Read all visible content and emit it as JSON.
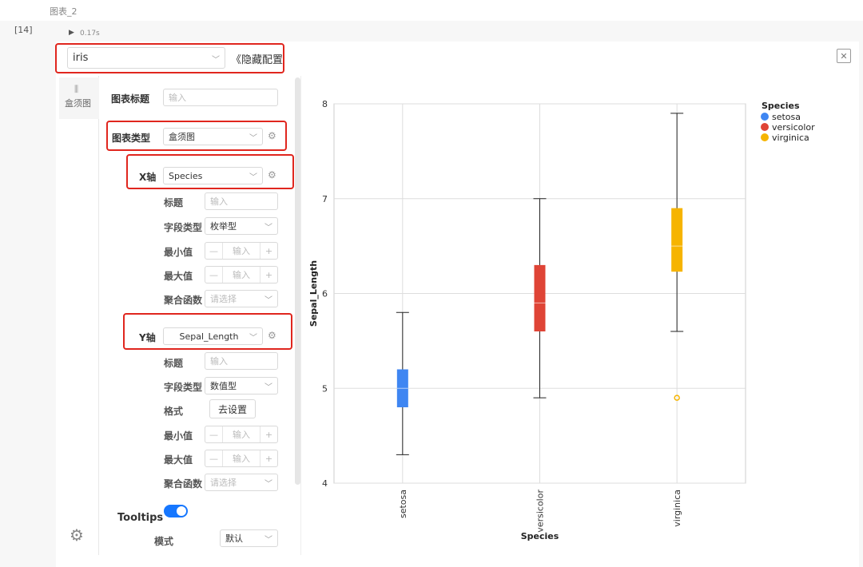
{
  "notebook": {
    "cell_title": "图表_2",
    "exec_count": "[14]",
    "run_time": "0.17s"
  },
  "dataset": {
    "selected": "iris",
    "hide_config_label": "《隐藏配置"
  },
  "sidebar": {
    "tab_label": "盒须图"
  },
  "config": {
    "chart_title_label": "图表标题",
    "chart_title_placeholder": "输入",
    "chart_type_label": "图表类型",
    "chart_type_value": "盒须图",
    "x_axis": {
      "label": "X轴",
      "field": "Species",
      "title_label": "标题",
      "title_placeholder": "输入",
      "field_type_label": "字段类型",
      "field_type_value": "枚举型",
      "min_label": "最小值",
      "min_placeholder": "输入",
      "max_label": "最大值",
      "max_placeholder": "输入",
      "agg_label": "聚合函数",
      "agg_placeholder": "请选择"
    },
    "y_axis": {
      "label": "Y轴",
      "field": "Sepal_Length",
      "title_label": "标题",
      "title_placeholder": "输入",
      "field_type_label": "字段类型",
      "field_type_value": "数值型",
      "format_label": "格式",
      "format_button": "去设置",
      "min_label": "最小值",
      "min_placeholder": "输入",
      "max_label": "最大值",
      "max_placeholder": "输入",
      "agg_label": "聚合函数",
      "agg_placeholder": "请选择"
    },
    "tooltips_label": "Tooltips",
    "tooltips_on": true,
    "mode_label": "模式",
    "mode_value": "默认",
    "stepper_minus": "—",
    "stepper_plus": "+"
  },
  "colors": {
    "setosa": "#3f86f2",
    "versicolor": "#df4436",
    "virginica": "#f6b400",
    "highlight": "#e0261e",
    "toggle": "#1677ff"
  },
  "chart_data": {
    "type": "boxplot",
    "xlabel": "Species",
    "ylabel": "Sepal_Length",
    "ylim": [
      4,
      8
    ],
    "yticks": [
      4,
      5,
      6,
      7,
      8
    ],
    "legend_title": "Species",
    "legend_position": "top-right",
    "grid": true,
    "series": [
      {
        "name": "setosa",
        "min": 4.3,
        "q1": 4.8,
        "median": 5.0,
        "q3": 5.2,
        "max": 5.8,
        "outliers": []
      },
      {
        "name": "versicolor",
        "min": 4.9,
        "q1": 5.6,
        "median": 5.9,
        "q3": 6.3,
        "max": 7.0,
        "outliers": []
      },
      {
        "name": "virginica",
        "min": 5.6,
        "q1": 6.23,
        "median": 6.5,
        "q3": 6.9,
        "max": 7.9,
        "outliers": [
          4.9
        ]
      }
    ]
  }
}
